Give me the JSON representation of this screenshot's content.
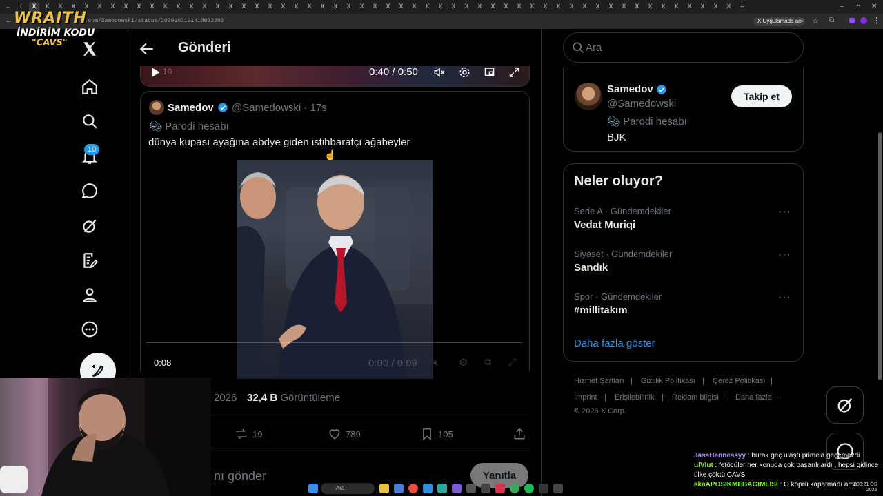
{
  "browser": {
    "url": "x.com/Samedowski/status/2039103191418032202",
    "open_in_app": "Uygulamada aç"
  },
  "overlay": {
    "brand": "WRAITH",
    "promo_line": "İNDİRİM KODU",
    "promo_code": "\"CAVS\""
  },
  "nav": {
    "notifications_badge": "10"
  },
  "header": {
    "title": "Gönderi"
  },
  "top_video": {
    "time": "0:40 / 0:50",
    "faded_time": "10"
  },
  "quote": {
    "name": "Samedov",
    "handle": "@Samedowski · 17s",
    "parody": "Parodi hesabı",
    "text": "dünya kupası ayağına abdye giden istihbaratçı ağabeyler",
    "video_elapsed": "0:08",
    "video_faded_time": "0:00 / 0:09",
    "video_progress": 0.0
  },
  "meta": {
    "date": "2026",
    "views_count": "32,4 B",
    "views_label": "Görüntüleme"
  },
  "actions": {
    "retweets": "19",
    "likes": "789",
    "bookmarks": "105"
  },
  "reply": {
    "placeholder": "nı gönder",
    "button": "Yanıtla"
  },
  "search": {
    "placeholder": "Ara"
  },
  "profile": {
    "name": "Samedov",
    "handle": "@Samedowski",
    "parody": "Parodi hesabı",
    "bio": "BJK",
    "follow": "Takip et"
  },
  "trends": {
    "title": "Neler oluyor?",
    "items": [
      {
        "context": "Serie A · Gündemdekiler",
        "name": "Vedat Muriqi"
      },
      {
        "context": "Siyaset · Gündemdekiler",
        "name": "Sandık"
      },
      {
        "context": "Spor · Gündemdekiler",
        "name": "#millitakım"
      }
    ],
    "show_more": "Daha fazla göster"
  },
  "footer": {
    "links": [
      "Hizmet Şartları",
      "Gizlilik Politikası",
      "Çerez Politikası",
      "Imprint",
      "Erişilebilirlik",
      "Reklam bilgisi",
      "Daha fazla ···"
    ],
    "copyright": "© 2026 X Corp."
  },
  "chat": [
    {
      "user": "JassHennessyy",
      "msg": "burak geç ulaştı prime'a geçemezdi"
    },
    {
      "user": "ulVlut",
      "msg": "fetöcüler her konuda çok başarılılardı , hepsi gidince ülke çöktü CAVS"
    },
    {
      "user": "akaAPOSIKMEBAGIMLISI",
      "msg": "O köprü kapatmadı ama"
    }
  ],
  "taskbar": {
    "search": "Ara",
    "time": "7:00:21 ÖS",
    "date": "2026"
  },
  "colors": {
    "accent": "#1d9bf0",
    "border": "#2f3336",
    "muted": "#71767b",
    "brand_yellow": "#f2c230"
  }
}
